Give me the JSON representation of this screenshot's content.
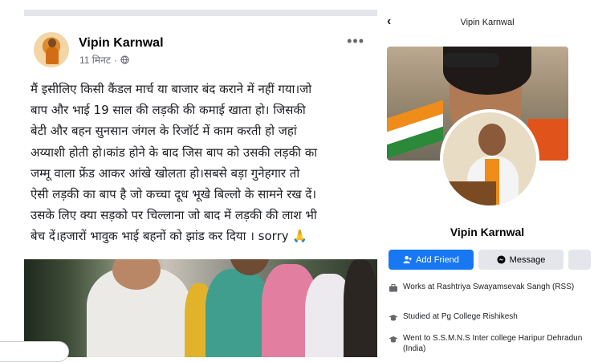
{
  "post": {
    "author": "Vipin Karnwal",
    "time": "11 मिनट",
    "more_icon": "more-horizontal-icon",
    "privacy_icon": "globe-icon",
    "text_lines": [
      "मैं इसीलिए किसी कैंडल मार्च या बाजार बंद कराने में नहीं गया।जो",
      "बाप और भाई 19 साल की लड़की की कमाई खाता हो। जिसकी",
      "बेटी और बहन सुनसान जंगल के रिजॉर्ट में काम करती हो जहां",
      "अय्याशी होती हो।कांड होने के बाद जिस बाप को उसकी लड़की का",
      "जम्मू वाला फ्रेंड आकर आंखे खोलता हो।सबसे बड़ा गुनेहगार तो",
      "ऐसी लड़की का बाप है जो कच्चा दूध भूखे बिल्लो के सामने रख दें।",
      "उसके लिए क्या सड़को पर चिल्लाना जो बाद में लड़की की लाश भी",
      "बेच दें।हजारों भावुक भाई बहनों को झांड कर दिया । sorry 🙏"
    ]
  },
  "profile": {
    "topbar_title": "Vipin Karnwal",
    "back_icon": "chevron-left-icon",
    "name": "Vipin Karnwal",
    "add_friend_label": "Add Friend",
    "message_label": "Message",
    "info": [
      {
        "icon": "briefcase-icon",
        "text": "Works at Rashtriya Swayamsevak Sangh (RSS)"
      },
      {
        "icon": "graduation-cap-icon",
        "text": "Studied at Pg College Rishikesh"
      },
      {
        "icon": "graduation-cap-icon",
        "text": "Went to S.S.M.N.S Inter college Haripur Dehradun (India)"
      }
    ]
  },
  "colors": {
    "primary_blue": "#1877f2",
    "secondary_button": "#e4e6eb",
    "muted_text": "#65676b",
    "saffron": "#f08c1a"
  }
}
